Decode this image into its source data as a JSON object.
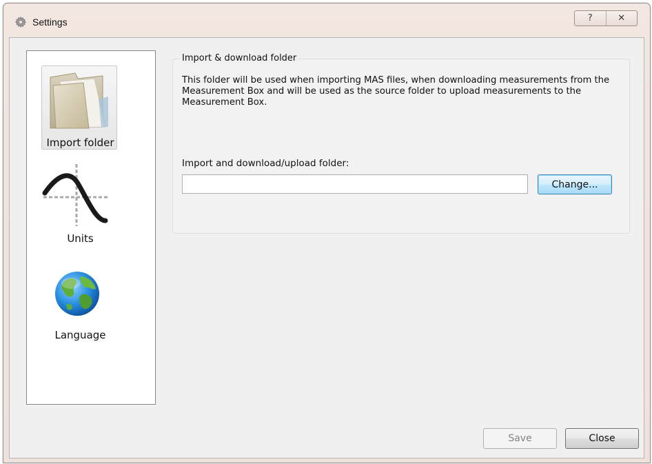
{
  "window": {
    "title": "Settings",
    "help_label": "?",
    "close_label": "✕"
  },
  "sidebar": {
    "items": [
      {
        "label": "Import folder",
        "icon": "folder-icon",
        "selected": true
      },
      {
        "label": "Units",
        "icon": "graph-curve-icon",
        "selected": false
      },
      {
        "label": "Language",
        "icon": "globe-icon",
        "selected": false
      }
    ]
  },
  "import_section": {
    "legend": "Import & download folder",
    "description": "This folder will be used when importing MAS files, when downloading measurements from the Measurement Box and will be used as the source folder to upload measurements to the Measurement Box.",
    "folder_label": "Import and download/upload folder:",
    "folder_value": "",
    "change_label": "Change..."
  },
  "footer": {
    "save_label": "Save",
    "close_label": "Close"
  },
  "colors": {
    "title_bar": "#f1e4df",
    "client_bg": "#f0f0f0",
    "accent_button": "#3c7fb1"
  }
}
